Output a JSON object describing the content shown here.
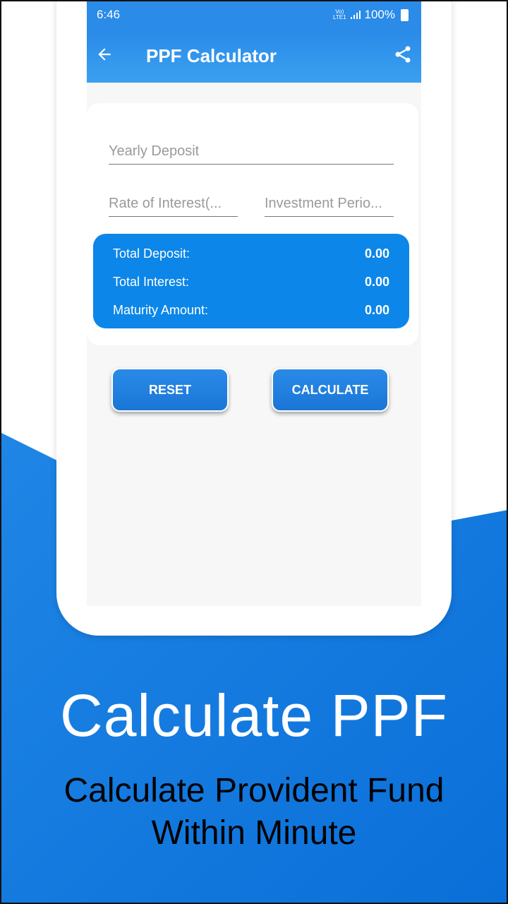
{
  "status": {
    "time": "6:46",
    "network": "Vo) LTE1",
    "battery": "100%"
  },
  "appbar": {
    "title": "PPF Calculator"
  },
  "form": {
    "yearly_deposit_placeholder": "Yearly Deposit",
    "rate_placeholder": "Rate of Interest(...",
    "period_placeholder": "Investment Perio..."
  },
  "results": [
    {
      "label": "Total Deposit:",
      "value": "0.00"
    },
    {
      "label": "Total Interest:",
      "value": "0.00"
    },
    {
      "label": "Maturity Amount:",
      "value": "0.00"
    }
  ],
  "buttons": {
    "reset": "RESET",
    "calculate": "CALCULATE"
  },
  "promo": {
    "headline": "Calculate PPF",
    "subline_1": "Calculate Provident Fund",
    "subline_2": "Within Minute"
  },
  "colors": {
    "brand_blue": "#2b8be8",
    "results_blue": "#0c86e8",
    "wave_blue": "#1a7fe0"
  }
}
